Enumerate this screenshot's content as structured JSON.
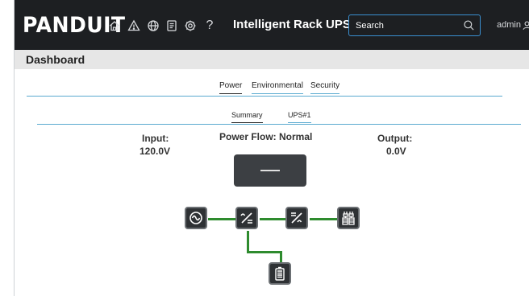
{
  "brand": {
    "logo_text": "PANDUIT"
  },
  "nav": {
    "icons": [
      "home-icon",
      "alert-icon",
      "globe-icon",
      "document-icon",
      "settings-icon",
      "help-icon"
    ],
    "help_glyph": "?"
  },
  "app_title": "Intelligent Rack UPS",
  "search": {
    "placeholder": "Search"
  },
  "user": {
    "name": "admin"
  },
  "page_title": "Dashboard",
  "tabs": [
    {
      "label": "Power",
      "active": true
    },
    {
      "label": "Environmental",
      "active": false
    },
    {
      "label": "Security",
      "active": false
    }
  ],
  "subtabs": [
    {
      "label": "Summary",
      "active": true
    },
    {
      "label": "UPS#1",
      "active": false
    }
  ],
  "status": {
    "input_label": "Input:",
    "input_value": "120.0V",
    "flow_label": "Power Flow: Normal",
    "output_label": "Output:",
    "output_value": "0.0V"
  },
  "diagram": {
    "components": [
      "ac-source-icon",
      "rectifier-icon",
      "inverter-icon",
      "outlets-icon",
      "battery-icon"
    ],
    "wire_color": "#2e8b2e"
  },
  "colors": {
    "topbar": "#1d1f22",
    "accent": "#5aaad0",
    "search_border": "#3a8fd0"
  }
}
